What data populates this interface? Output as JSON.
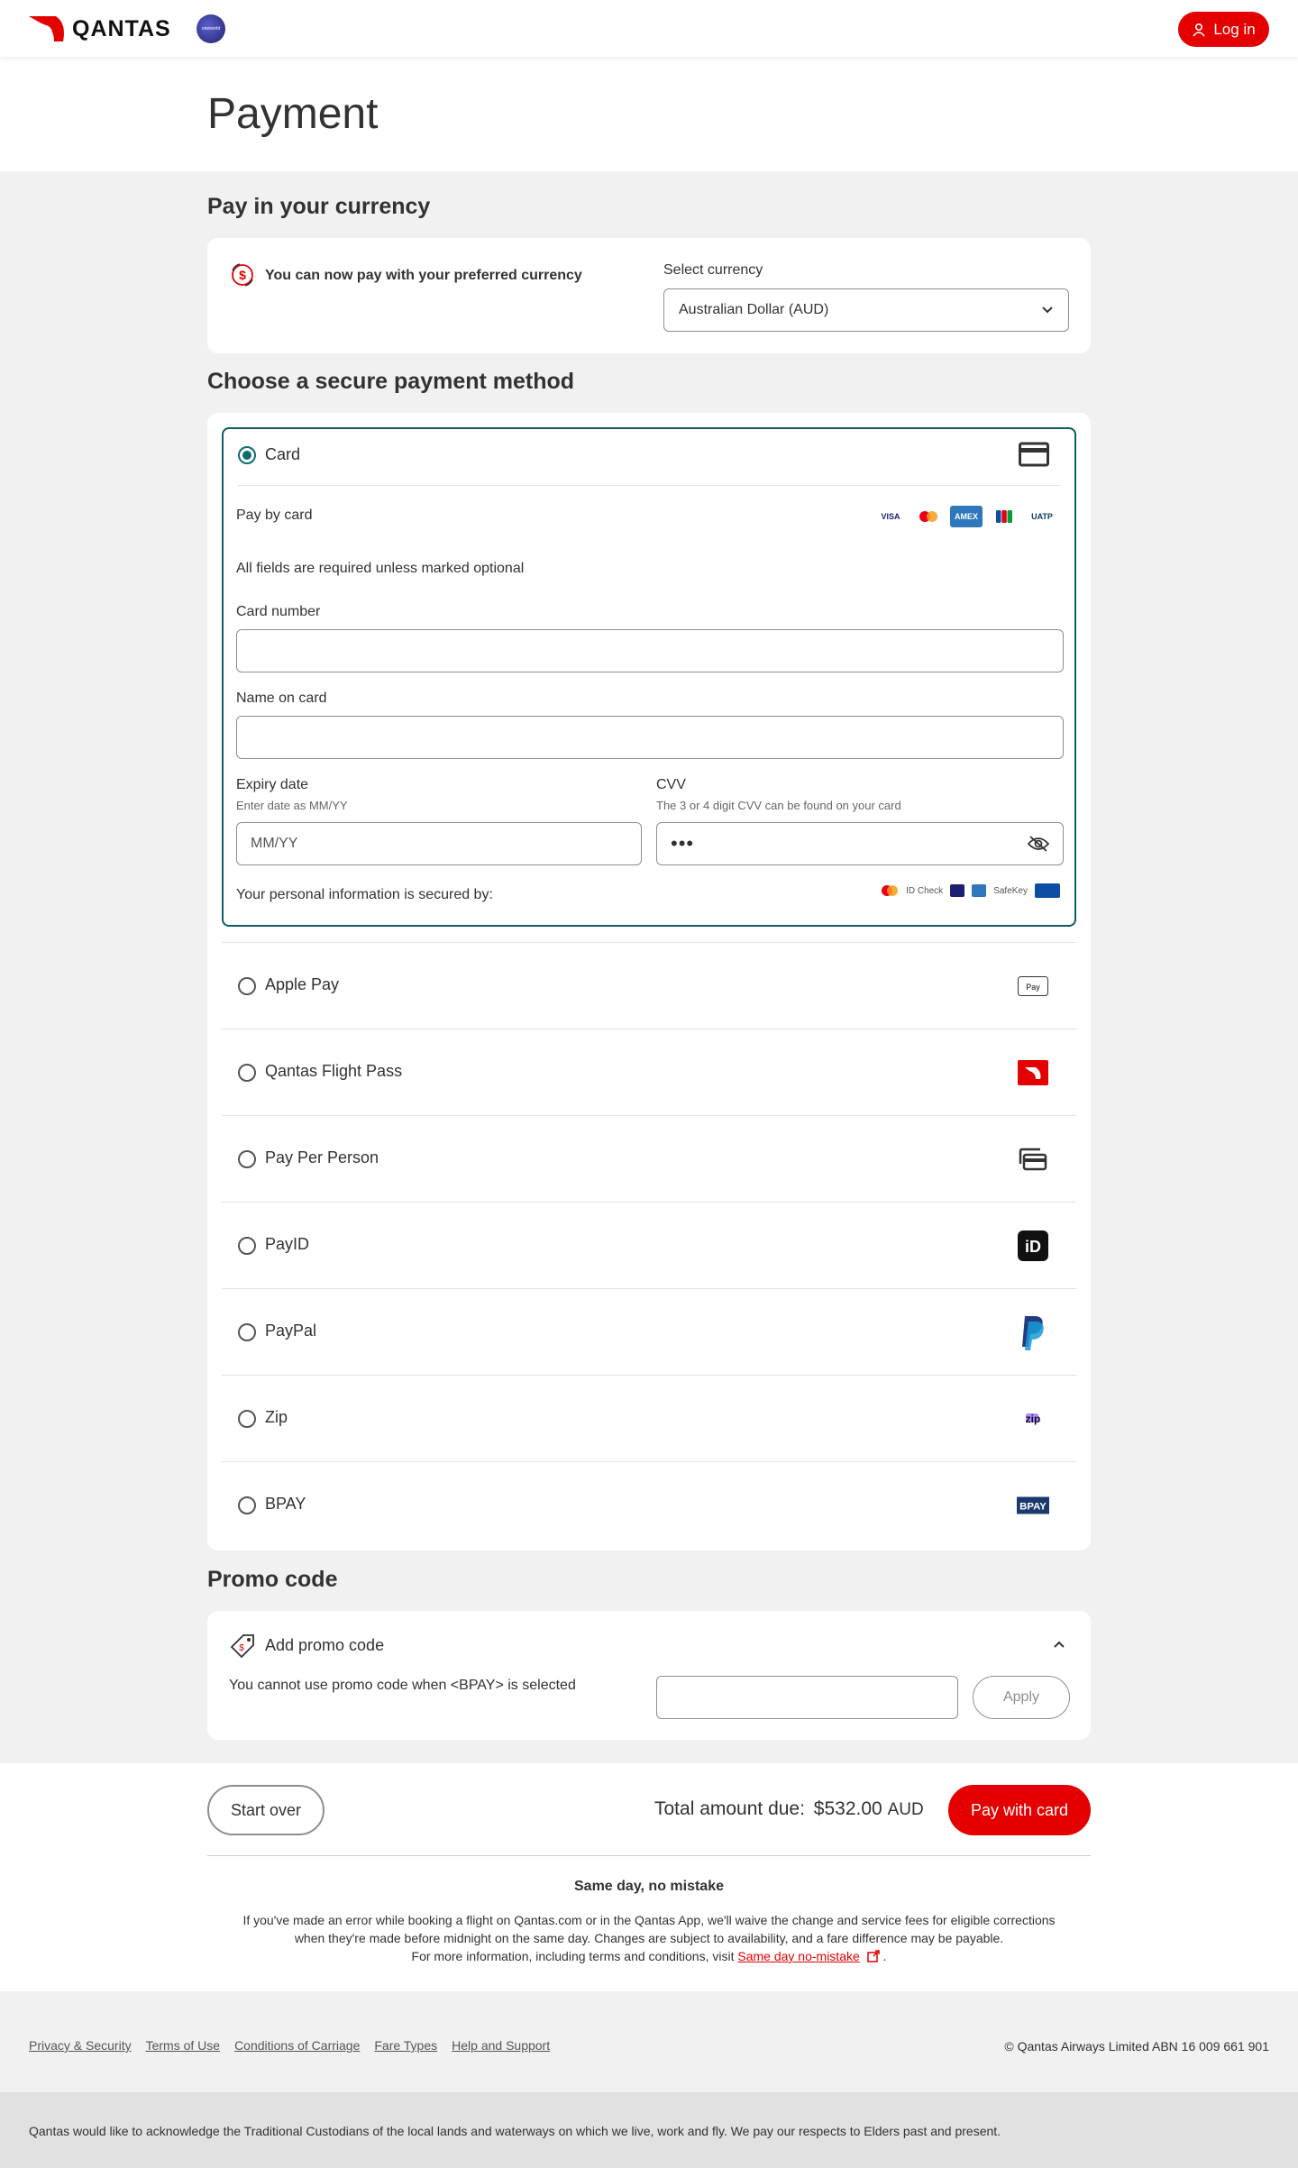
{
  "header": {
    "brand": "QANTAS",
    "oneworld": "oneworld",
    "login_label": "Log in"
  },
  "page_title": "Payment",
  "currency": {
    "section_title": "Pay in your currency",
    "message": "You can now pay with your preferred currency",
    "select_label": "Select currency",
    "selected": "Australian Dollar (AUD)"
  },
  "payment": {
    "section_title": "Choose a secure payment method",
    "card": {
      "label": "Card",
      "pay_by_card": "Pay by card",
      "networks": [
        "VISA",
        "MC",
        "AMEX",
        "JCB",
        "UATP"
      ],
      "required_note": "All fields are required unless marked optional",
      "card_number_label": "Card number",
      "name_label": "Name on card",
      "expiry_label": "Expiry date",
      "expiry_hint": "Enter date as MM/YY",
      "expiry_placeholder": "MM/YY",
      "cvv_label": "CVV",
      "cvv_hint": "The 3 or 4 digit CVV can be found on your card",
      "cvv_value": "•••",
      "secured_label": "Your personal information is secured by:",
      "secure_badges": [
        "ID Check",
        "Verified by VISA",
        "SafeKey",
        "J/Secure"
      ]
    },
    "methods": [
      {
        "label": "Apple Pay",
        "icon": "apple-pay-icon"
      },
      {
        "label": "Qantas Flight Pass",
        "icon": "qantas-flight-pass-icon"
      },
      {
        "label": "Pay Per Person",
        "icon": "cards-icon"
      },
      {
        "label": "PayID",
        "icon": "payid-icon"
      },
      {
        "label": "PayPal",
        "icon": "paypal-icon"
      },
      {
        "label": "Zip",
        "icon": "zip-icon"
      },
      {
        "label": "BPAY",
        "icon": "bpay-icon"
      }
    ]
  },
  "promo": {
    "section_title": "Promo code",
    "add_label": "Add promo code",
    "note": "You cannot use promo code when <BPAY> is selected",
    "apply_label": "Apply"
  },
  "summary": {
    "start_over": "Start over",
    "total_label": "Total amount due:",
    "total_amount": "$532.00",
    "currency": "AUD",
    "pay_button": "Pay with card"
  },
  "same_day": {
    "title": "Same day, no mistake",
    "line1": "If you've made an error while booking a flight on Qantas.com or in the Qantas App, we'll waive the change and service fees for eligible corrections",
    "line2": "when they're made before midnight on the same day. Changes are subject to availability, and a fare difference may be payable.",
    "line3_prefix": "For more information, including terms and conditions, visit ",
    "link": "Same day no-mistake",
    "line3_suffix": " ."
  },
  "footer": {
    "links": [
      "Privacy & Security",
      "Terms of Use",
      "Conditions of Carriage",
      "Fare Types",
      "Help and Support"
    ],
    "copyright": "© Qantas Airways Limited ABN 16 009 661 901",
    "acknowledgement": "Qantas would like to acknowledge the Traditional Custodians of the local lands and waterways on which we live, work and fly.  We pay our respects to Elders past and present."
  },
  "colors": {
    "brand_red": "#e40000",
    "selected_teal": "#0e5b61"
  }
}
